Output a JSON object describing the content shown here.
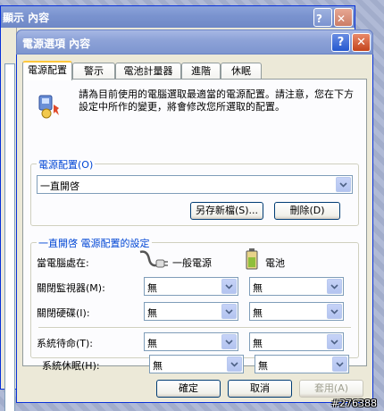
{
  "back_window": {
    "title": "顯示 內容"
  },
  "window": {
    "title": "電源選項 內容"
  },
  "tabs": [
    {
      "label": "電源配置"
    },
    {
      "label": "警示"
    },
    {
      "label": "電池計量器"
    },
    {
      "label": "進階"
    },
    {
      "label": "休眠"
    }
  ],
  "intro_text": "請為目前使用的電腦選取最適當的電源配置。請注意，您在下方設定中所作的變更，將會修改您所選取的配置。",
  "scheme_group": {
    "legend": "電源配置(O)",
    "selected": "一直開啓",
    "save_as_label": "另存新檔(S)...",
    "delete_label": "刪除(D)"
  },
  "settings_group": {
    "legend": "一直開啓 電源配置的設定",
    "when_label": "當電腦處在:",
    "col_ac": "一般電源",
    "col_battery": "電池",
    "rows": [
      {
        "label": "關閉監視器(M):",
        "ac": "無",
        "battery": "無"
      },
      {
        "label": "關閉硬碟(I):",
        "ac": "無",
        "battery": "無"
      },
      {
        "label": "系統待命(T):",
        "ac": "無",
        "battery": "無"
      },
      {
        "label": "系統休眠(H):",
        "ac": "無",
        "battery": "無"
      }
    ]
  },
  "footer": {
    "ok_label": "確定",
    "cancel_label": "取消",
    "apply_label": "套用(A)"
  },
  "watermark": "#276388",
  "icons": {
    "help": "help-icon",
    "close": "close-icon",
    "dropdown": "chevron-down-icon",
    "plug": "power-plug-icon",
    "battery": "battery-icon"
  },
  "colors": {
    "accent": "#0046d5",
    "tab_highlight": "#ffc83c"
  }
}
